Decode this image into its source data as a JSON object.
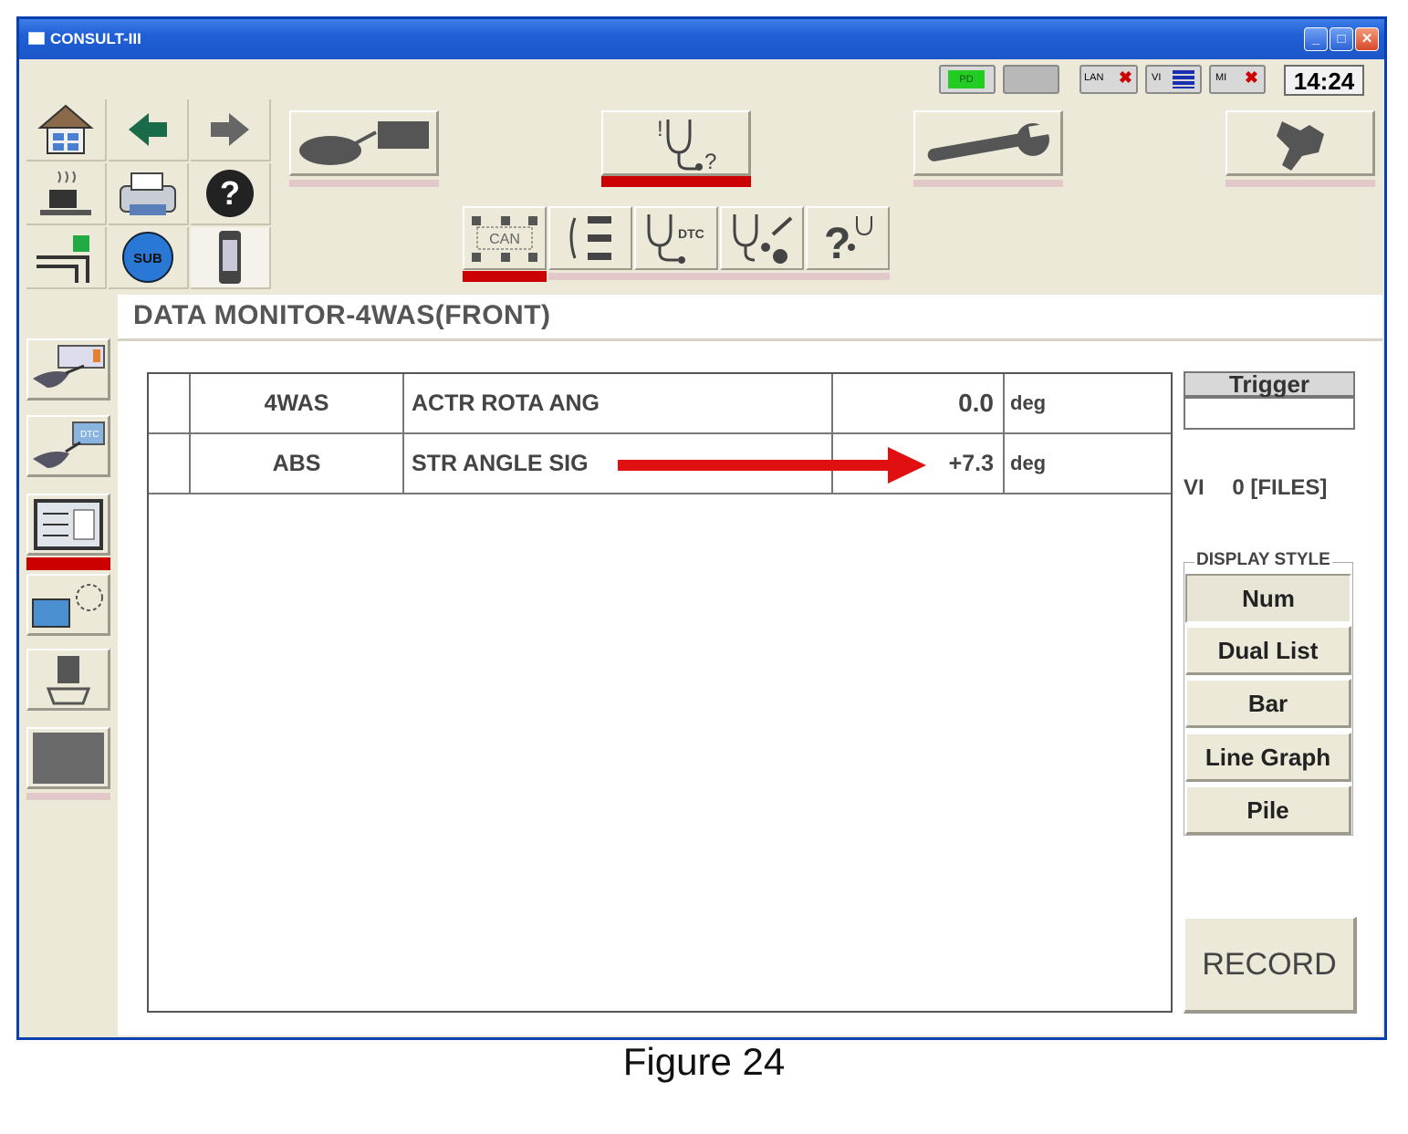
{
  "window": {
    "title": "CONSULT-III",
    "controls": [
      "minimize",
      "maximize",
      "close"
    ]
  },
  "status": {
    "indicators": [
      "PD",
      "",
      "LAN",
      "VI",
      "MI"
    ],
    "clock": "14:24"
  },
  "toolbar": {
    "icons": [
      "home-icon",
      "back-arrow-icon",
      "forward-arrow-icon",
      "coffee-icon",
      "printer-icon",
      "help-icon",
      "screen-capture-icon",
      "sub-icon",
      "vi-device-icon"
    ],
    "sub_label": "SUB",
    "main_buttons": [
      "select-vehicle",
      "diagnosis",
      "repair",
      "settings"
    ],
    "sub_buttons": [
      "CAN",
      "data-list",
      "DTC",
      "work-support",
      "help"
    ],
    "can_label": "CAN",
    "dtc_label": "DTC"
  },
  "sidebar": {
    "items": [
      "self-diagnosis",
      "dtc-diagnosis",
      "data-monitor",
      "active-test",
      "work-support",
      "blank"
    ]
  },
  "page_title": "DATA MONITOR-4WAS(FRONT)",
  "table": {
    "rows": [
      {
        "system": "4WAS",
        "item": "ACTR ROTA ANG",
        "value": "0.0",
        "unit": "deg"
      },
      {
        "system": "ABS",
        "item": "STR ANGLE SIG",
        "value": "+7.3",
        "unit": "deg"
      }
    ]
  },
  "right_panel": {
    "trigger_label": "Trigger",
    "vi_label": "VI",
    "files_label": "0 [FILES]",
    "display_style_label": "DISPLAY STYLE",
    "display_buttons": [
      "Num",
      "Dual List",
      "Bar",
      "Line Graph",
      "Pile"
    ],
    "record_label": "RECORD"
  },
  "caption": "Figure 24",
  "colors": {
    "titlebar": "#1f5fd6",
    "accent_red": "#cc0000",
    "panel": "#ece9d8"
  }
}
